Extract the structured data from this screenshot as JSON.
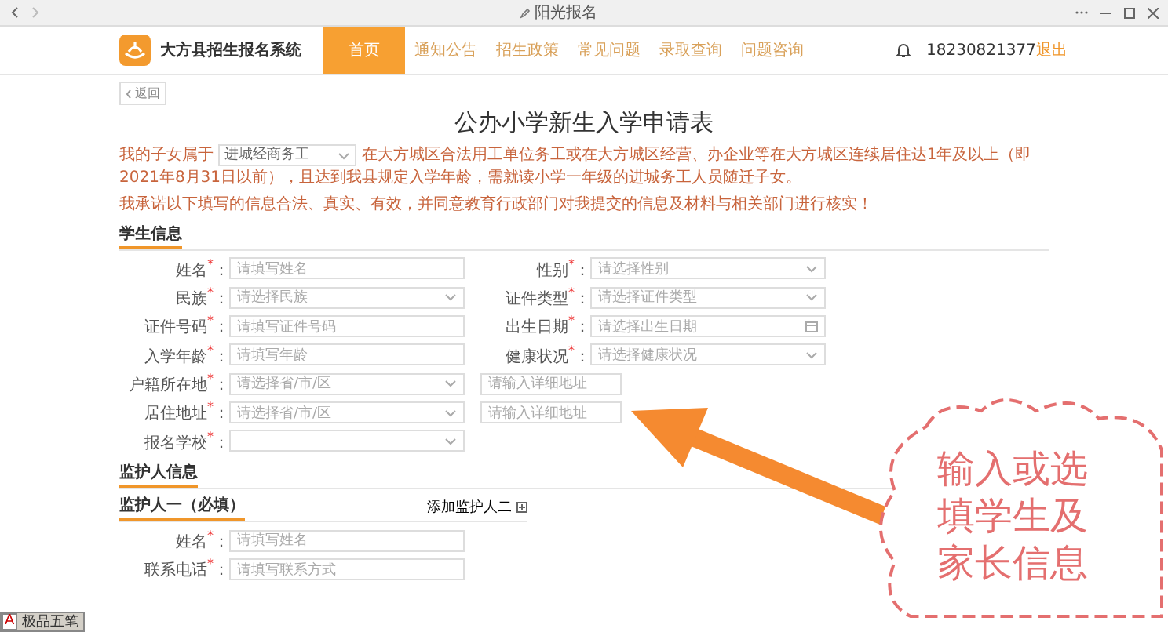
{
  "window": {
    "title": "阳光报名"
  },
  "header": {
    "logo_text": "大方县招生报名系统",
    "nav": [
      {
        "label": "首页",
        "selected": true
      },
      {
        "label": "通知公告",
        "selected": false
      },
      {
        "label": "招生政策",
        "selected": false
      },
      {
        "label": "常见问题",
        "selected": false
      },
      {
        "label": "录取查询",
        "selected": false
      },
      {
        "label": "问题咨询",
        "selected": false
      }
    ],
    "phone": "18230821377",
    "logout": "退出"
  },
  "back_button": "返回",
  "form_title": "公办小学新生入学申请表",
  "intro": {
    "prefix": "我的子女属于",
    "category": "进城经商务工",
    "text": "在大方城区合法用工单位务工或在大方城区经营、办企业等在大方城区连续居住达1年及以上（即2021年8月31日以前），且达到我县规定入学年龄，需就读小学一年级的进城务工人员随迁子女。",
    "pledge": "我承诺以下填写的信息合法、真实、有效，并同意教育行政部门对我提交的信息及材料与相关部门进行核实！"
  },
  "student_section": {
    "title": "学生信息",
    "rows": [
      [
        {
          "label": "姓名$^{*}$：",
          "kind": "text",
          "placeholder": "请填写姓名"
        },
        {
          "label": "性别$^{*}$：",
          "kind": "select",
          "placeholder": "请选择性别"
        }
      ],
      [
        {
          "label": "民族$^{*}$：",
          "kind": "select",
          "placeholder": "请选择民族"
        },
        {
          "label": "证件类型$^{*}$：",
          "kind": "select",
          "placeholder": "请选择证件类型"
        }
      ],
      [
        {
          "label": "证件号码$^{*}$：",
          "kind": "text",
          "placeholder": "请填写证件号码"
        },
        {
          "label": "出生日期$^{*}$：",
          "kind": "date",
          "placeholder": "请选择出生日期"
        }
      ],
      [
        {
          "label": "入学年龄$^{*}$：",
          "kind": "text",
          "placeholder": "请填写年龄"
        },
        {
          "label": "健康状况$^{*}$：",
          "kind": "select",
          "placeholder": "请选择健康状况"
        }
      ],
      [
        {
          "label": "户籍所在地$^{*}$：",
          "kind": "select",
          "placeholder": "请选择省/市/区"
        },
        {
          "kind": "detail",
          "placeholder": "请输入详细地址"
        }
      ],
      [
        {
          "label": "居住地址$^{*}$：",
          "kind": "select",
          "placeholder": "请选择省/市/区"
        },
        {
          "kind": "detail",
          "placeholder": "请输入详细地址"
        }
      ],
      [
        {
          "label": "报名学校$^{*}$：",
          "kind": "select"
        }
      ]
    ]
  },
  "guardian_section": {
    "title": "监护人信息",
    "subtitle": "监护人一（必填）",
    "add_button": "添加监护人二",
    "fields": [
      {
        "label": "姓名$^{*}$：",
        "kind": "text",
        "placeholder": "请填写姓名"
      },
      {
        "label": "联系电话$^{*}$：",
        "kind": "text",
        "placeholder": "请填写联系方式"
      }
    ]
  },
  "annotation": {
    "text": "输入或选填学生及家长信息"
  },
  "ime_bar": {
    "indicator": "A",
    "label": "极品五笔"
  }
}
